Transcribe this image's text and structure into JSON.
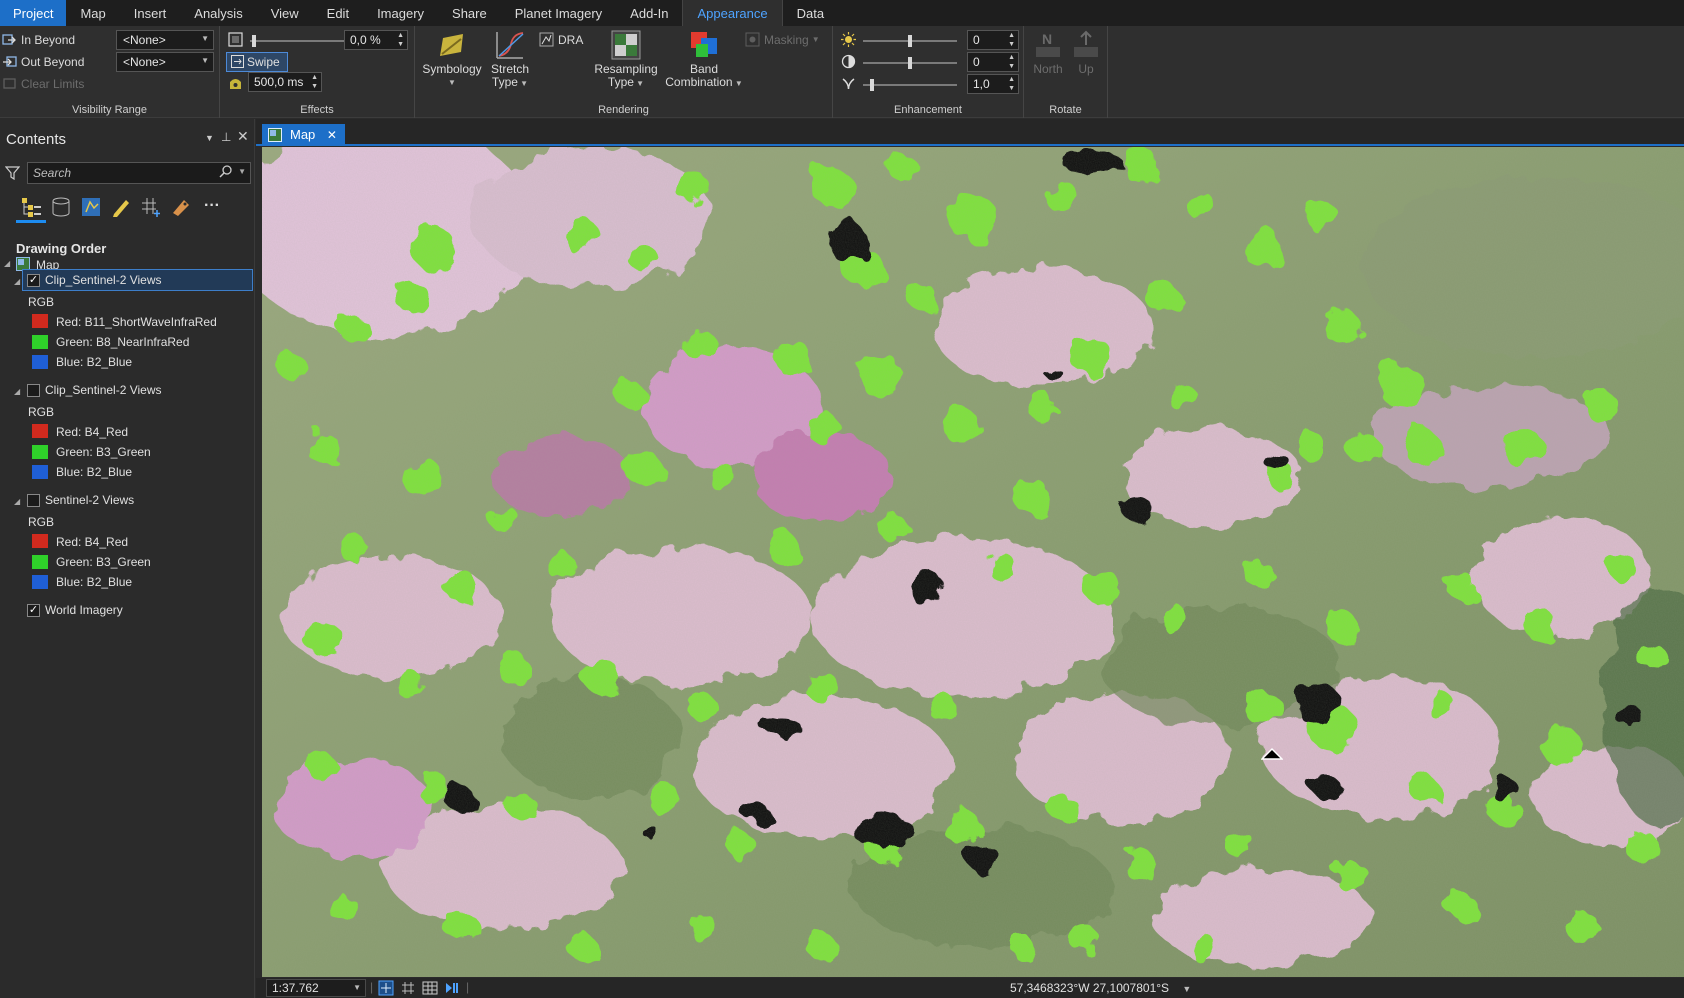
{
  "tabs": [
    "Project",
    "Map",
    "Insert",
    "Analysis",
    "View",
    "Edit",
    "Imagery",
    "Share",
    "Planet Imagery",
    "Add-In",
    "Appearance",
    "Data"
  ],
  "ribbon": {
    "visibility": {
      "in_beyond": "In Beyond",
      "out_beyond": "Out Beyond",
      "clear_limits": "Clear Limits",
      "in_value": "<None>",
      "out_value": "<None>",
      "label": "Visibility Range"
    },
    "effects": {
      "transparency": "0,0  %",
      "swipe": "Swipe",
      "flicker": "500,0  ms",
      "label": "Effects"
    },
    "rendering": {
      "symbology": "Symbology",
      "stretch_1": "Stretch",
      "stretch_2": "Type",
      "dra": "DRA",
      "resampling_1": "Resampling",
      "resampling_2": "Type",
      "band_1": "Band",
      "band_2": "Combination",
      "masking": "Masking",
      "label": "Rendering"
    },
    "enhancement": {
      "brightness": "0",
      "contrast": "0",
      "gamma": "1,0",
      "label": "Enhancement"
    },
    "rotate": {
      "north": "North",
      "up": "Up",
      "label": "Rotate"
    }
  },
  "contents": {
    "title": "Contents",
    "search_placeholder": "Search",
    "drawing_order": "Drawing Order",
    "map_label": "Map",
    "layers": [
      {
        "name": "Clip_Sentinel-2 Views",
        "checked": true,
        "renderer": "RGB",
        "bands": [
          {
            "label": "Red:  B11_ShortWaveInfraRed",
            "color": "#d12a1e"
          },
          {
            "label": "Green: B8_NearInfraRed",
            "color": "#2fd12a"
          },
          {
            "label": "Blue:  B2_Blue",
            "color": "#1f5fd6"
          }
        ]
      },
      {
        "name": "Clip_Sentinel-2 Views",
        "checked": false,
        "renderer": "RGB",
        "bands": [
          {
            "label": "Red:  B4_Red",
            "color": "#d12a1e"
          },
          {
            "label": "Green: B3_Green",
            "color": "#2fd12a"
          },
          {
            "label": "Blue:  B2_Blue",
            "color": "#1f5fd6"
          }
        ]
      },
      {
        "name": "Sentinel-2 Views",
        "checked": false,
        "renderer": "RGB",
        "bands": [
          {
            "label": "Red:  B4_Red",
            "color": "#d12a1e"
          },
          {
            "label": "Green: B3_Green",
            "color": "#2fd12a"
          },
          {
            "label": "Blue:  B2_Blue",
            "color": "#1f5fd6"
          }
        ]
      }
    ],
    "world_imagery": "World Imagery"
  },
  "map": {
    "tab_label": "Map",
    "scale": "1:37.762",
    "coordinates": "57,3468323°W 27,1007801°S"
  },
  "colors": {
    "accent": "#1d6fc8",
    "active_tab_text": "#4ea3ff",
    "vegetation": "#7ee23a",
    "water": "#0b0b0b",
    "bare_soil": "#e8c4df"
  }
}
